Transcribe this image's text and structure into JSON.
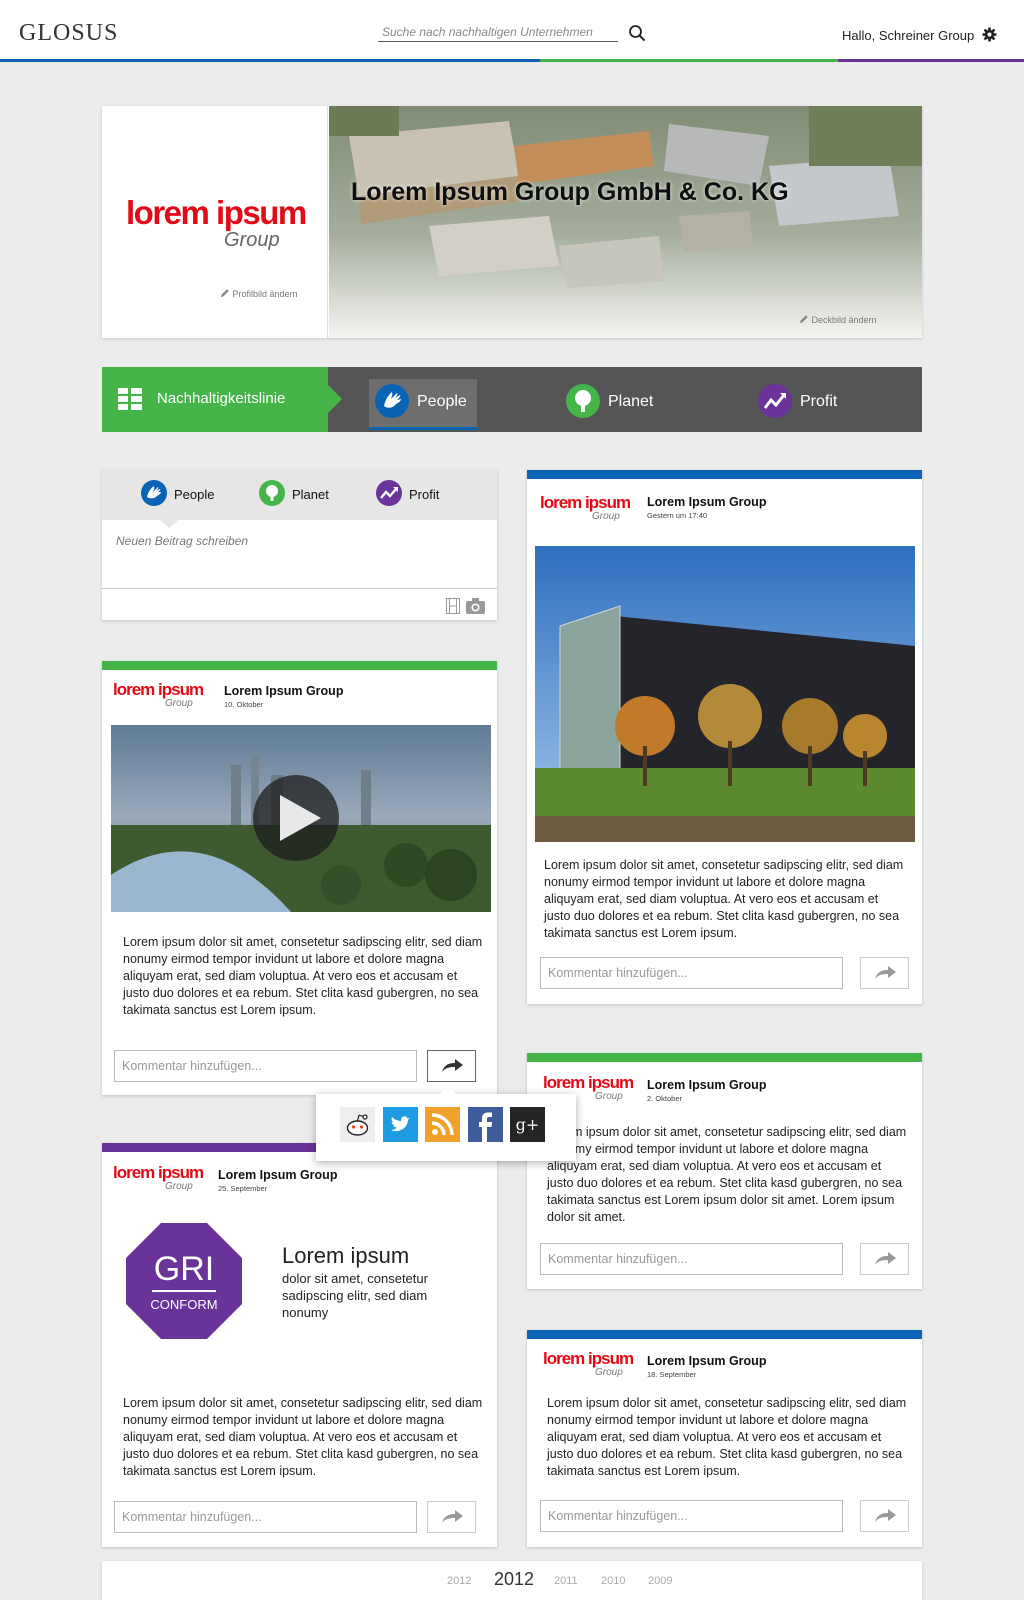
{
  "app": {
    "logo": "GLOSUS"
  },
  "search": {
    "placeholder": "Suche nach nachhaltigen Unternehmen"
  },
  "user": {
    "greeting": "Hallo, Schreiner Group"
  },
  "colors": {
    "people": "#0a63b5",
    "planet": "#45b449",
    "profit": "#6a3399"
  },
  "profile": {
    "brand_line1": "lorem ipsum",
    "brand_line2": "Group",
    "company_name": "Lorem Ipsum Group GmbH & Co. KG",
    "change_profile_pic": "Profilbild ändern",
    "change_cover": "Deckbild ändern"
  },
  "nav": {
    "timeline_label": "Nachhaltigkeitslinie",
    "tabs": [
      {
        "label": "People",
        "icon": "hand-icon"
      },
      {
        "label": "Planet",
        "icon": "tree-icon"
      },
      {
        "label": "Profit",
        "icon": "chart-arrow-icon"
      }
    ]
  },
  "composer": {
    "tabs": [
      "People",
      "Planet",
      "Profit"
    ],
    "placeholder": "Neuen Beitrag schreiben"
  },
  "comment_placeholder": "Kommentar hinzufügen...",
  "posts": [
    {
      "author": "Lorem Ipsum Group",
      "date": "Gestern um 17:40",
      "text": "Lorem ipsum dolor sit amet, consetetur sadipscing elitr, sed diam nonumy eirmod tempor invidunt ut labore et dolore magna aliquyam erat, sed diam voluptua. At vero eos et accusam et justo duo dolores et ea rebum. Stet clita kasd gubergren, no sea takimata sanctus est Lorem ipsum."
    },
    {
      "author": "Lorem Ipsum Group",
      "date": "10. Oktober",
      "text": "Lorem ipsum dolor sit amet, consetetur sadipscing elitr, sed diam nonumy eirmod tempor invidunt ut labore et dolore magna aliquyam erat, sed diam voluptua. At vero eos et accusam et justo duo dolores et ea rebum. Stet clita kasd gubergren, no sea takimata sanctus est Lorem ipsum."
    },
    {
      "author": "Lorem Ipsum Group",
      "date": "2. Oktober",
      "text": "Lorem ipsum dolor sit amet, consetetur sadipscing elitr, sed diam nonumy eirmod tempor invidunt ut labore et dolore magna aliquyam erat, sed diam voluptua. At vero eos et accusam et justo duo dolores et ea rebum. Stet clita kasd gubergren, no sea takimata sanctus est Lorem ipsum dolor sit amet. Lorem ipsum dolor sit amet."
    },
    {
      "author": "Lorem Ipsum Group",
      "date": "25. September",
      "gri_line1": "GRI",
      "gri_line2": "CONFORM",
      "gri_heading": "Lorem ipsum",
      "gri_sub": "dolor sit amet, consetetur sadipscing elitr, sed diam nonumy",
      "text": "Lorem ipsum dolor sit amet, consetetur sadipscing elitr, sed diam nonumy eirmod tempor invidunt ut labore et dolore magna aliquyam erat, sed diam voluptua. At vero eos et accusam et justo duo dolores et ea rebum. Stet clita kasd gubergren, no sea takimata sanctus est Lorem ipsum."
    },
    {
      "author": "Lorem Ipsum Group",
      "date": "18. September",
      "text": "Lorem ipsum dolor sit amet, consetetur sadipscing elitr, sed diam nonumy eirmod tempor invidunt ut labore et dolore magna aliquyam erat, sed diam voluptua. At vero eos et accusam et justo duo dolores et ea rebum. Stet clita kasd gubergren, no sea takimata sanctus est Lorem ipsum."
    }
  ],
  "share": {
    "icons": [
      "reddit-icon",
      "twitter-icon",
      "rss-icon",
      "facebook-icon",
      "google-plus-icon"
    ],
    "gplus_label": "g+"
  },
  "years": [
    "2012",
    "2012",
    "2011",
    "2010",
    "2009"
  ]
}
